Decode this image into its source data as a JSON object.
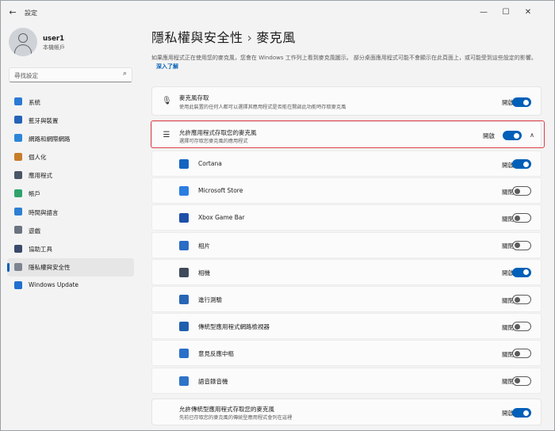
{
  "window": {
    "back_glyph": "←",
    "title": "設定",
    "controls": {
      "minimize": "—",
      "maximize": "☐",
      "close": "✕"
    }
  },
  "user": {
    "name": "user1",
    "type": "本機帳戶"
  },
  "search": {
    "placeholder": "尋找設定",
    "icon": "search-icon",
    "glyph": "⌕"
  },
  "sidebar": {
    "items": [
      {
        "label": "系統",
        "icon": "system-icon",
        "color": "#2b79d6"
      },
      {
        "label": "藍牙與裝置",
        "icon": "bluetooth-icon",
        "color": "#2563b8"
      },
      {
        "label": "網路和網際網路",
        "icon": "network-icon",
        "color": "#2d86d9"
      },
      {
        "label": "個人化",
        "icon": "personalization-icon",
        "color": "#c77d2a"
      },
      {
        "label": "應用程式",
        "icon": "apps-icon",
        "color": "#4a5565"
      },
      {
        "label": "帳戶",
        "icon": "accounts-icon",
        "color": "#2fa26b"
      },
      {
        "label": "時間與語言",
        "icon": "time-language-icon",
        "color": "#2e7fd3"
      },
      {
        "label": "遊戲",
        "icon": "gaming-icon",
        "color": "#6b7280"
      },
      {
        "label": "協助工具",
        "icon": "accessibility-icon",
        "color": "#3a4a6b"
      },
      {
        "label": "隱私權與安全性",
        "icon": "privacy-icon",
        "color": "#7d8590",
        "active": true
      },
      {
        "label": "Windows Update",
        "icon": "windows-update-icon",
        "color": "#1f6fd1"
      }
    ]
  },
  "page": {
    "breadcrumb_parent": "隱私權與安全性",
    "separator": "›",
    "title": "麥克風",
    "description": "如果應用程式正在使用您的麥克風，您會在 Windows 工作列上看到麥克風圖示。 部分桌面應用程式可能不會顯示在此頁面上，或可能受到這些設定的影響。",
    "learn_more": "深入了解"
  },
  "mic_access": {
    "title": "麥克風存取",
    "subtitle": "使用此裝置的任何人都可以選擇其應用程式是否能在開啟此功能時存取麥克風",
    "state": "開啟",
    "icon_glyph": "🎙",
    "on": true
  },
  "apps_access": {
    "title": "允許應用程式存取您的麥克風",
    "subtitle": "選擇可存取您麥克風的應用程式",
    "state": "開啟",
    "icon_glyph": "☰",
    "chevron": "∧",
    "on": true
  },
  "apps": [
    {
      "name": "Cortana",
      "state": "開啟",
      "on": true,
      "icon": "cortana-icon",
      "color": "#1565c0"
    },
    {
      "name": "Microsoft Store",
      "state": "關閉",
      "on": false,
      "icon": "microsoft-store-icon",
      "color": "#2a7de1"
    },
    {
      "name": "Xbox Game Bar",
      "state": "關閉",
      "on": false,
      "icon": "xbox-game-bar-icon",
      "color": "#1e4fa8"
    },
    {
      "name": "相片",
      "state": "關閉",
      "on": false,
      "icon": "photos-icon",
      "color": "#2b6cc4"
    },
    {
      "name": "相機",
      "state": "開啟",
      "on": true,
      "icon": "camera-icon",
      "color": "#3f4a5a"
    },
    {
      "name": "進行測驗",
      "state": "關閉",
      "on": false,
      "icon": "take-a-test-icon",
      "color": "#2766b5"
    },
    {
      "name": "傳統型應用程式網路檢視器",
      "state": "關閉",
      "on": false,
      "icon": "webview-icon",
      "color": "#1f5fae"
    },
    {
      "name": "意見反應中樞",
      "state": "關閉",
      "on": false,
      "icon": "feedback-hub-icon",
      "color": "#2a70c8"
    },
    {
      "name": "語音錄音機",
      "state": "關閉",
      "on": false,
      "icon": "voice-recorder-icon",
      "color": "#2d73c8"
    }
  ],
  "desktop_apps": {
    "title": "允許傳統型應用程式存取您的麥克風",
    "subtitle": "先前已存取您的麥克風的傳統型應用程式會列在這裡",
    "state": "開啟",
    "on": true
  }
}
